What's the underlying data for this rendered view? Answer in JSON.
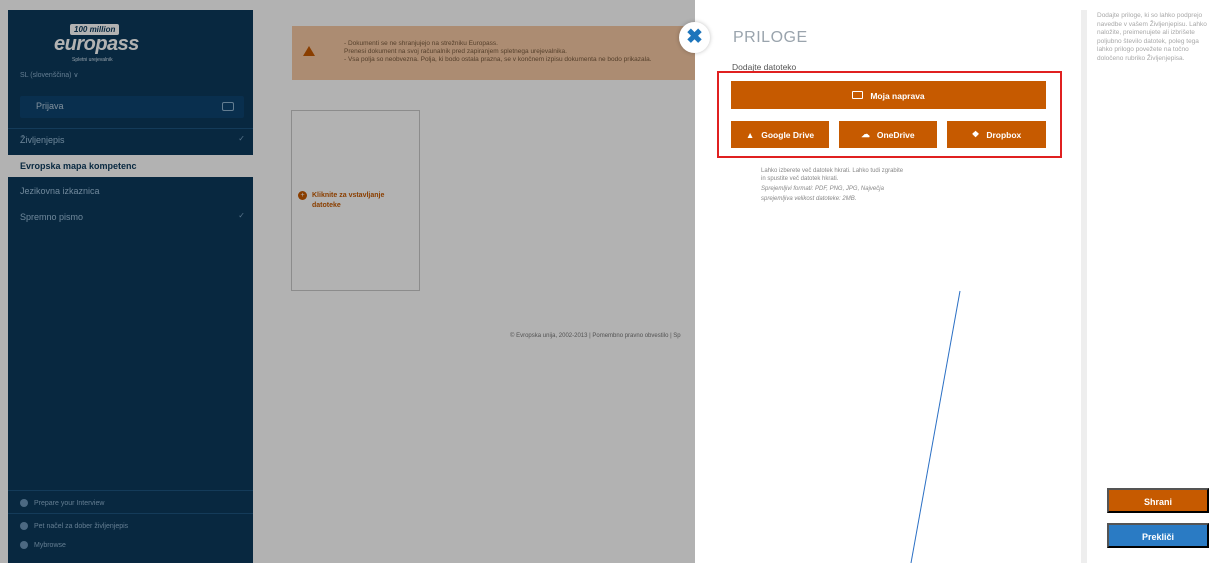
{
  "sidebar": {
    "logo": {
      "badge": "100 million",
      "text": "europass",
      "sub": "Spletni urejevalnik"
    },
    "language": "SL (slovenščina) ∨",
    "login_label": "Prijava",
    "items": [
      {
        "label": "Življenjepis",
        "active": false,
        "chevron": true
      },
      {
        "label": "Evropska mapa kompetenc",
        "active": true,
        "chevron": false
      },
      {
        "label": "Jezikovna izkaznica",
        "active": false,
        "chevron": false
      },
      {
        "label": "Spremno pismo",
        "active": false,
        "chevron": true
      }
    ],
    "bottom": [
      {
        "label": "Prepare your Interview",
        "icon": "chat-icon"
      },
      {
        "label": "Pet načel za dober življenjepis",
        "icon": "lightbulb-icon"
      },
      {
        "label": "Mybrowse",
        "icon": "gear-icon"
      }
    ]
  },
  "main": {
    "warning_lines": [
      "- Dokumenti se ne shranjujejo na strežniku Europass.",
      "Prenesi dokument na svoj računalnik pred zapiranjem spletnega urejevalnika.",
      "- Vsa polja so neobvezna. Polja, ki bodo ostala prazna, se v končnem izpisu dokumenta ne bodo prikazala."
    ],
    "upload_prompt": "Kliknite za vstavljanje datoteke",
    "copyright": "© Evropska unija, 2002-2013 | Pomembno pravno obvestilo | Sp"
  },
  "panel": {
    "title": "PRILOGE",
    "add_label": "Dodajte datoteko",
    "device_button": "Moja naprava",
    "google_button": "Google Drive",
    "onedrive_button": "OneDrive",
    "dropbox_button": "Dropbox",
    "help_line1": "Lahko izberete več datotek hkrati. Lahko tudi zgrabite",
    "help_line2": "in spustite več datotek hkrati.",
    "help_line3": "Sprejemljivi formati: PDF, PNG, JPG, Največja",
    "help_line4": "sprejemljiva velikost datoteke: 2MB."
  },
  "right": {
    "help_text": "Dodajte priloge, ki so lahko podprejo navedbe v vašem Življenjepisu. Lahko naložite, preimenujete ali izbrišete poljubno število datotek, poleg tega lahko prilogo povežete na točno določeno rubriko Življenjepisa.",
    "save_label": "Shrani",
    "cancel_label": "Prekliči"
  },
  "colors": {
    "accent_orange": "#c65a00",
    "accent_blue": "#2a7bc4",
    "sidebar_bg": "#0c3a5c",
    "highlight_red": "#e02020"
  }
}
